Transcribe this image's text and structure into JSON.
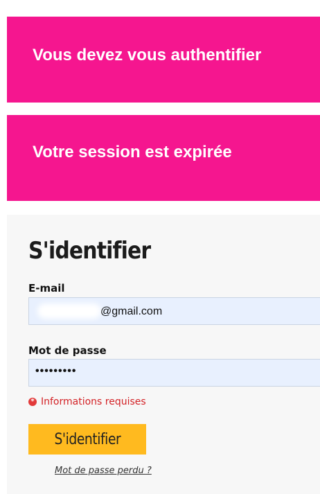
{
  "alerts": [
    {
      "text": "Vous devez vous authentifier"
    },
    {
      "text": "Votre session est expirée"
    }
  ],
  "colors": {
    "alert_bg": "#f5168f",
    "button_bg": "#ffba1f",
    "error": "#d32226",
    "input_bg": "#e8f0fe"
  },
  "login": {
    "title": "S'identifier",
    "email_label": "E-mail",
    "email_value": "@gmail.com",
    "password_label": "Mot de passe",
    "password_value": "•••••••••",
    "required_icon": "asterisk-icon",
    "required_text": "Informations requises",
    "submit_label": "S'identifier",
    "lost_password_link": "Mot de passe perdu ?"
  }
}
